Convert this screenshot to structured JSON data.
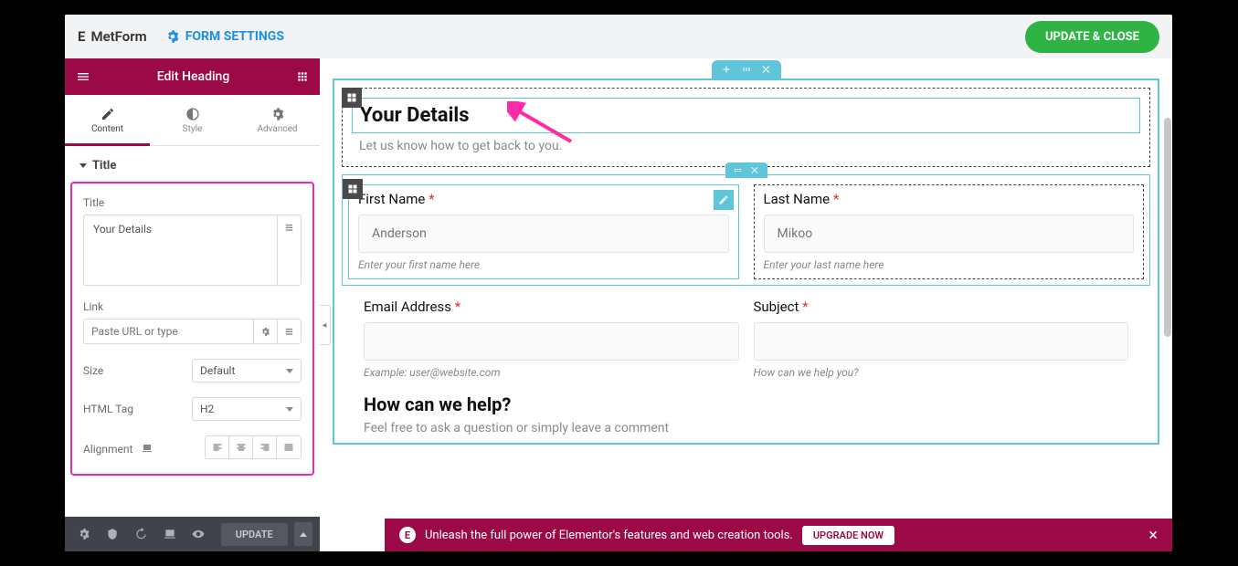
{
  "topbar": {
    "brand": "MetForm",
    "form_settings": "FORM SETTINGS",
    "update_close": "UPDATE & CLOSE"
  },
  "sidebar": {
    "header": "Edit Heading",
    "tabs": {
      "content": "Content",
      "style": "Style",
      "advanced": "Advanced"
    },
    "section_title": "Title",
    "title_label": "Title",
    "title_value": "Your Details",
    "link_label": "Link",
    "link_placeholder": "Paste URL or type",
    "size_label": "Size",
    "size_value": "Default",
    "html_tag_label": "HTML Tag",
    "html_tag_value": "H2",
    "alignment_label": "Alignment"
  },
  "footer": {
    "update": "UPDATE"
  },
  "canvas": {
    "heading": "Your Details",
    "subheading": "Let us know how to get back to you.",
    "first_name": {
      "label": "First Name",
      "placeholder": "Anderson",
      "help": "Enter your first name here"
    },
    "last_name": {
      "label": "Last Name",
      "placeholder": "Mikoo",
      "help": "Enter your last name here"
    },
    "email": {
      "label": "Email Address",
      "help": "Example: user@website.com"
    },
    "subject": {
      "label": "Subject",
      "help": "How can we help you?"
    },
    "help_heading": "How can we help?",
    "help_sub": "Feel free to ask a question or simply leave a comment"
  },
  "notice": {
    "text": "Unleash the full power of Elementor's features and web creation tools.",
    "upgrade": "UPGRADE NOW"
  }
}
